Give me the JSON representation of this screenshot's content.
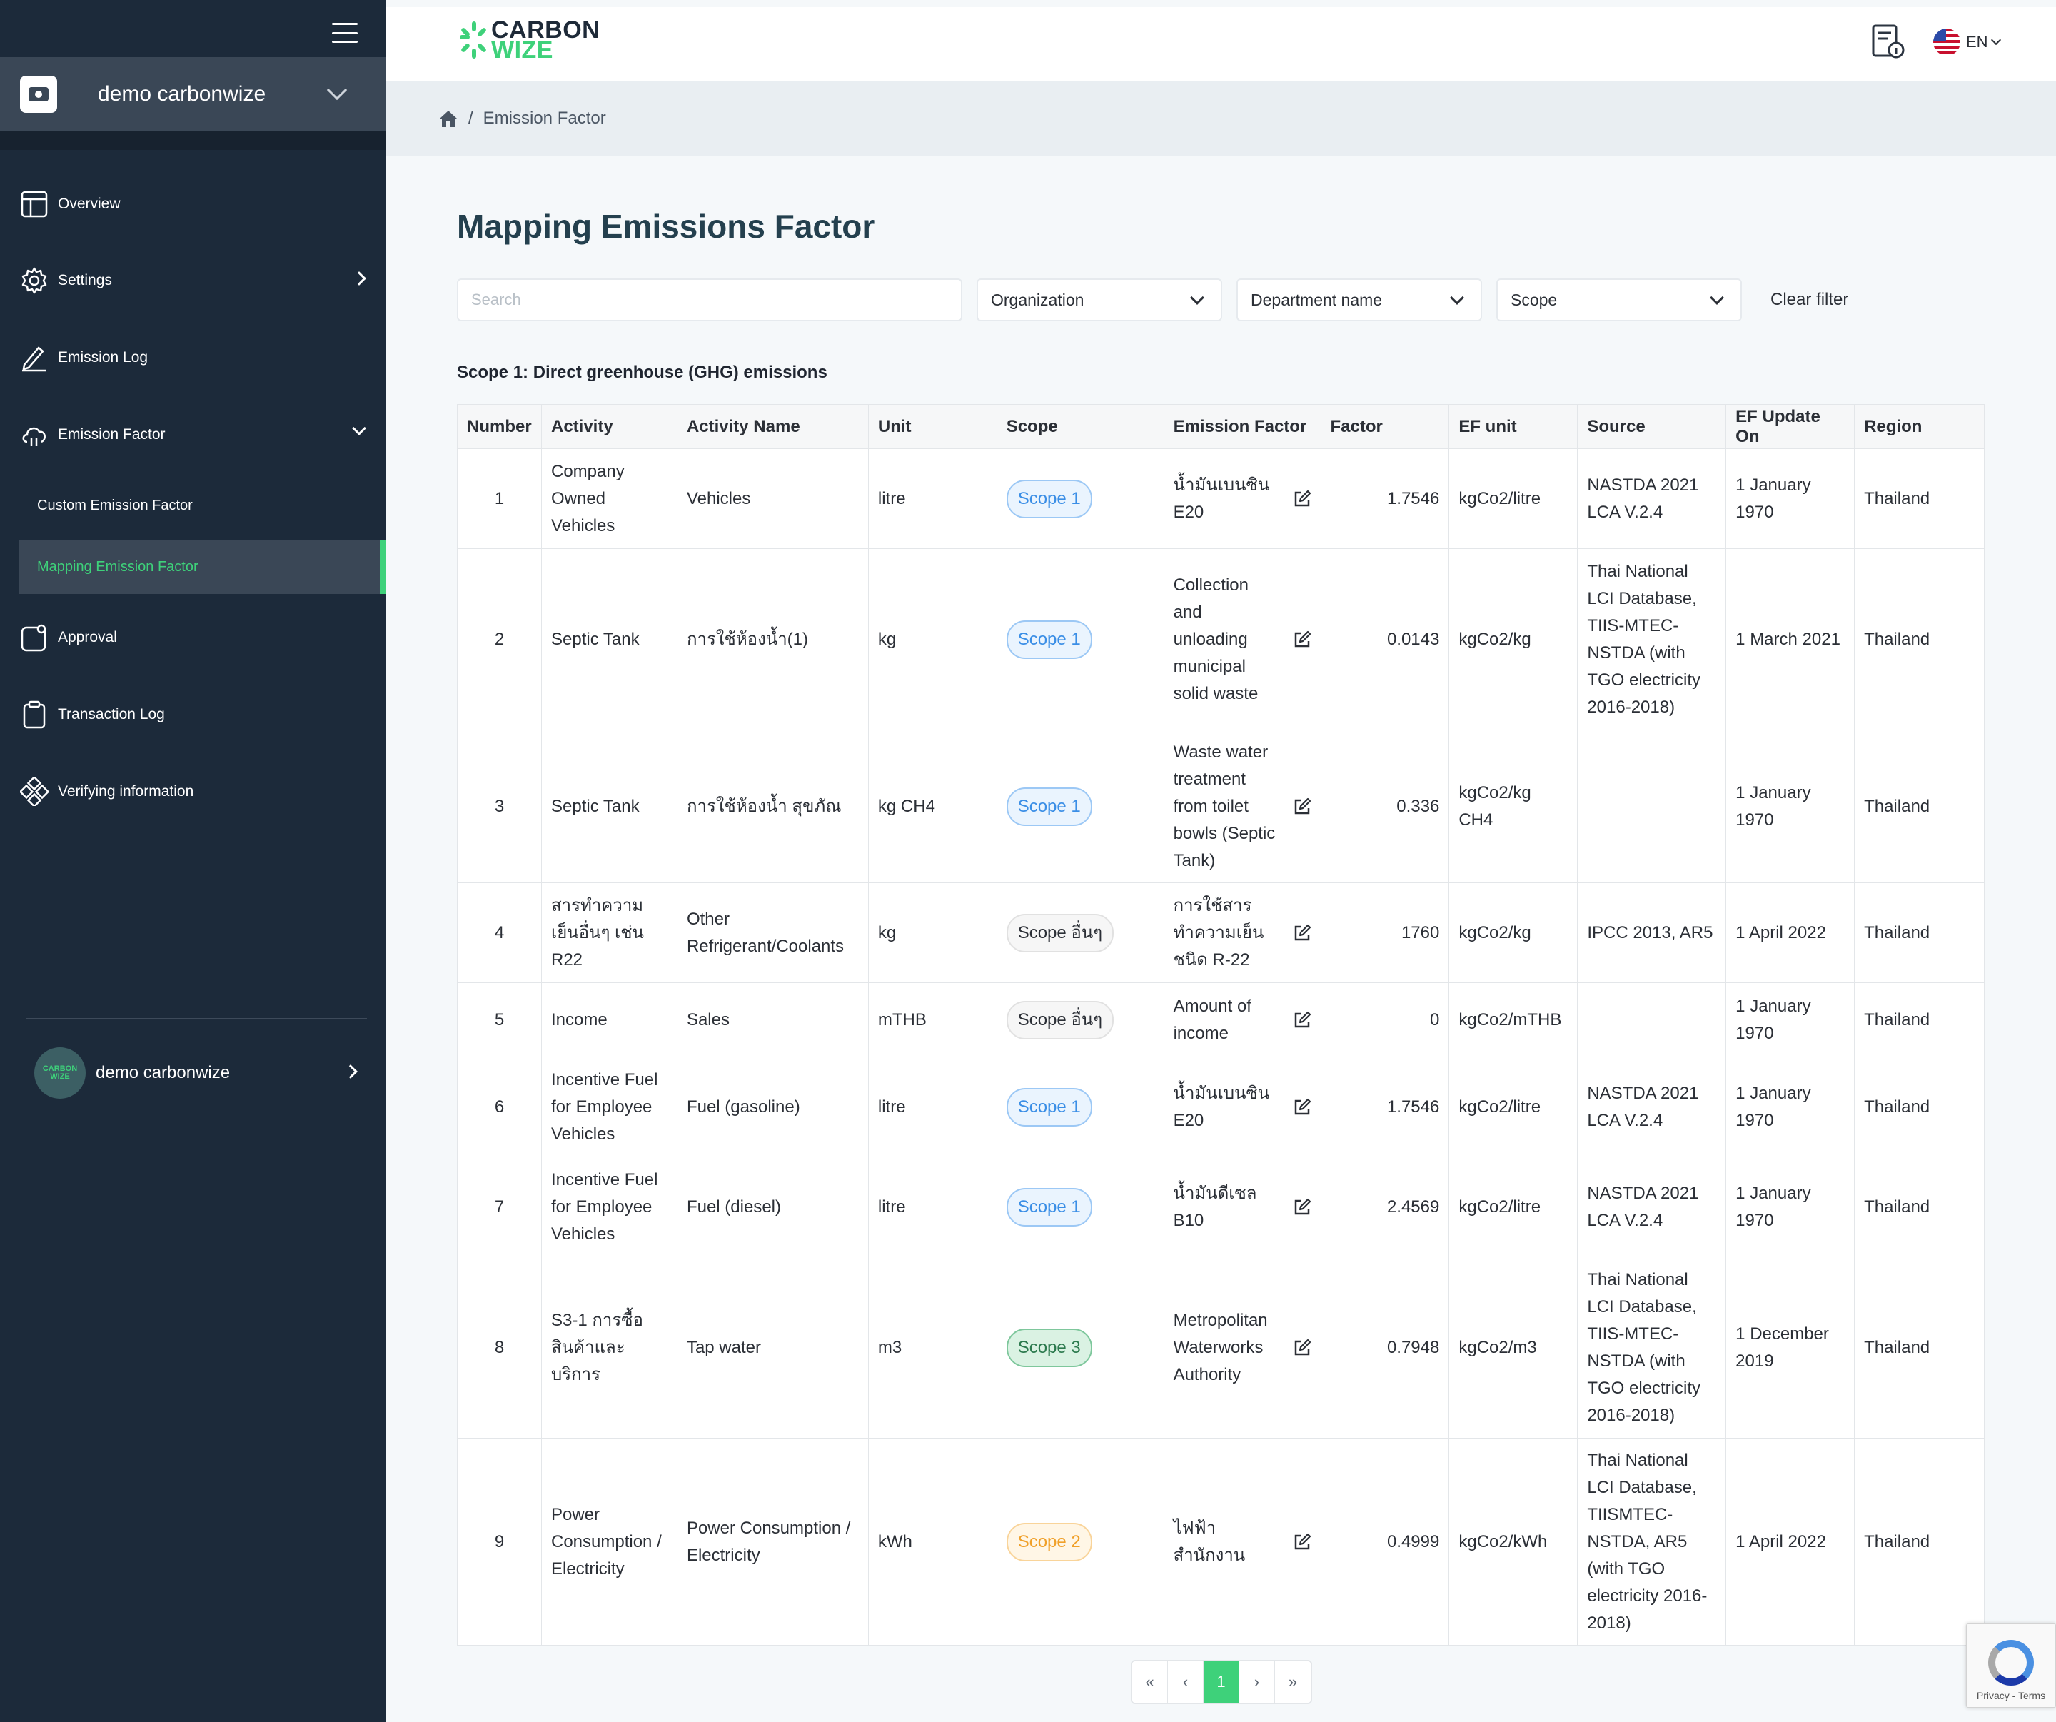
{
  "sidebar": {
    "org_name": "demo carbonwize",
    "nav": [
      {
        "label": "Overview"
      },
      {
        "label": "Settings"
      },
      {
        "label": "Emission Log"
      },
      {
        "label": "Emission Factor"
      },
      {
        "label": "Approval"
      },
      {
        "label": "Transaction Log"
      },
      {
        "label": "Verifying information"
      }
    ],
    "sub_nav": [
      {
        "label": "Custom Emission Factor"
      },
      {
        "label": "Mapping Emission Factor"
      }
    ],
    "user": {
      "name": "demo carbonwize",
      "avatar_text_top": "CARBON",
      "avatar_text_bottom": "WIZE"
    }
  },
  "topbar": {
    "logo_line1": "CARBON",
    "logo_line2": "WIZE",
    "language": "EN",
    "accent_color": "#3ed17a"
  },
  "breadcrumb": {
    "separator": "/",
    "current": "Emission Factor"
  },
  "page": {
    "title": "Mapping Emissions Factor",
    "search_placeholder": "Search",
    "filters": {
      "organization": "Organization",
      "department": "Department name",
      "scope": "Scope",
      "clear": "Clear filter"
    },
    "section_title": "Scope 1: Direct greenhouse (GHG) emissions"
  },
  "table": {
    "headers": [
      "Number",
      "Activity",
      "Activity Name",
      "Unit",
      "Scope",
      "Emission Factor",
      "Factor",
      "EF unit",
      "Source",
      "EF Update On",
      "Region"
    ],
    "rows": [
      {
        "number": "1",
        "activity": "Company Owned Vehicles",
        "activity_name": "Vehicles",
        "unit": "litre",
        "scope": "Scope 1",
        "scope_class": "s1",
        "emission_factor": "น้ำมันเบนซิน E20",
        "factor": "1.7546",
        "ef_unit": "kgCo2/litre",
        "source": "NASTDA 2021 LCA V.2.4",
        "updated": "1 January 1970",
        "region": "Thailand"
      },
      {
        "number": "2",
        "activity": "Septic Tank",
        "activity_name": "การใช้ห้องน้ำ(1)",
        "unit": "kg",
        "scope": "Scope 1",
        "scope_class": "s1",
        "emission_factor": "Collection and unloading municipal solid waste",
        "factor": "0.0143",
        "ef_unit": "kgCo2/kg",
        "source": "Thai National LCI Database, TIIS-MTEC-NSTDA (with TGO electricity 2016-2018)",
        "updated": "1 March 2021",
        "region": "Thailand"
      },
      {
        "number": "3",
        "activity": "Septic Tank",
        "activity_name": "การใช้ห้องน้ำ สุขภัณ",
        "unit": "kg CH4",
        "scope": "Scope 1",
        "scope_class": "s1",
        "emission_factor": "Waste water treatment from toilet bowls (Septic Tank)",
        "factor": "0.336",
        "ef_unit": "kgCo2/kg CH4",
        "source": "",
        "updated": "1 January 1970",
        "region": "Thailand"
      },
      {
        "number": "4",
        "activity": "สารทำความเย็นอื่นๆ เช่น R22",
        "activity_name": "Other Refrigerant/Coolants",
        "unit": "kg",
        "scope": "Scope อื่นๆ",
        "scope_class": "so",
        "emission_factor": "การใช้สารทำความเย็นชนิด R-22",
        "factor": "1760",
        "ef_unit": "kgCo2/kg",
        "source": "IPCC 2013, AR5",
        "updated": "1 April 2022",
        "region": "Thailand"
      },
      {
        "number": "5",
        "activity": "Income",
        "activity_name": "Sales",
        "unit": "mTHB",
        "scope": "Scope อื่นๆ",
        "scope_class": "so",
        "emission_factor": "Amount of income",
        "factor": "0",
        "ef_unit": "kgCo2/mTHB",
        "source": "",
        "updated": "1 January 1970",
        "region": "Thailand"
      },
      {
        "number": "6",
        "activity": "Incentive Fuel for Employee Vehicles",
        "activity_name": "Fuel (gasoline)",
        "unit": "litre",
        "scope": "Scope 1",
        "scope_class": "s1",
        "emission_factor": "น้ำมันเบนซิน E20",
        "factor": "1.7546",
        "ef_unit": "kgCo2/litre",
        "source": "NASTDA 2021 LCA V.2.4",
        "updated": "1 January 1970",
        "region": "Thailand"
      },
      {
        "number": "7",
        "activity": "Incentive Fuel for Employee Vehicles",
        "activity_name": "Fuel (diesel)",
        "unit": "litre",
        "scope": "Scope 1",
        "scope_class": "s1",
        "emission_factor": "น้ำมันดีเซล B10",
        "factor": "2.4569",
        "ef_unit": "kgCo2/litre",
        "source": "NASTDA 2021 LCA V.2.4",
        "updated": "1 January 1970",
        "region": "Thailand"
      },
      {
        "number": "8",
        "activity": "S3-1 การซื้อสินค้าและบริการ",
        "activity_name": "Tap water",
        "unit": "m3",
        "scope": "Scope 3",
        "scope_class": "s3",
        "emission_factor": "Metropolitan Waterworks Authority",
        "factor": "0.7948",
        "ef_unit": "kgCo2/m3",
        "source": "Thai National LCI Database, TIIS-MTEC-NSTDA (with TGO electricity 2016-2018)",
        "updated": "1 December 2019",
        "region": "Thailand"
      },
      {
        "number": "9",
        "activity": "Power Consumption / Electricity",
        "activity_name": "Power Consumption / Electricity",
        "unit": "kWh",
        "scope": "Scope 2",
        "scope_class": "s2",
        "emission_factor": "ไฟฟ้าสำนักงาน",
        "factor": "0.4999",
        "ef_unit": "kgCo2/kWh",
        "source": "Thai National LCI Database, TIISMTEC-NSTDA, AR5 (with TGO electricity 2016-2018)",
        "updated": "1 April 2022",
        "region": "Thailand"
      }
    ]
  },
  "pagination": {
    "first": "«",
    "prev": "‹",
    "current": "1",
    "next": "›",
    "last": "»"
  },
  "recaptcha": {
    "text": "Privacy - Terms"
  }
}
